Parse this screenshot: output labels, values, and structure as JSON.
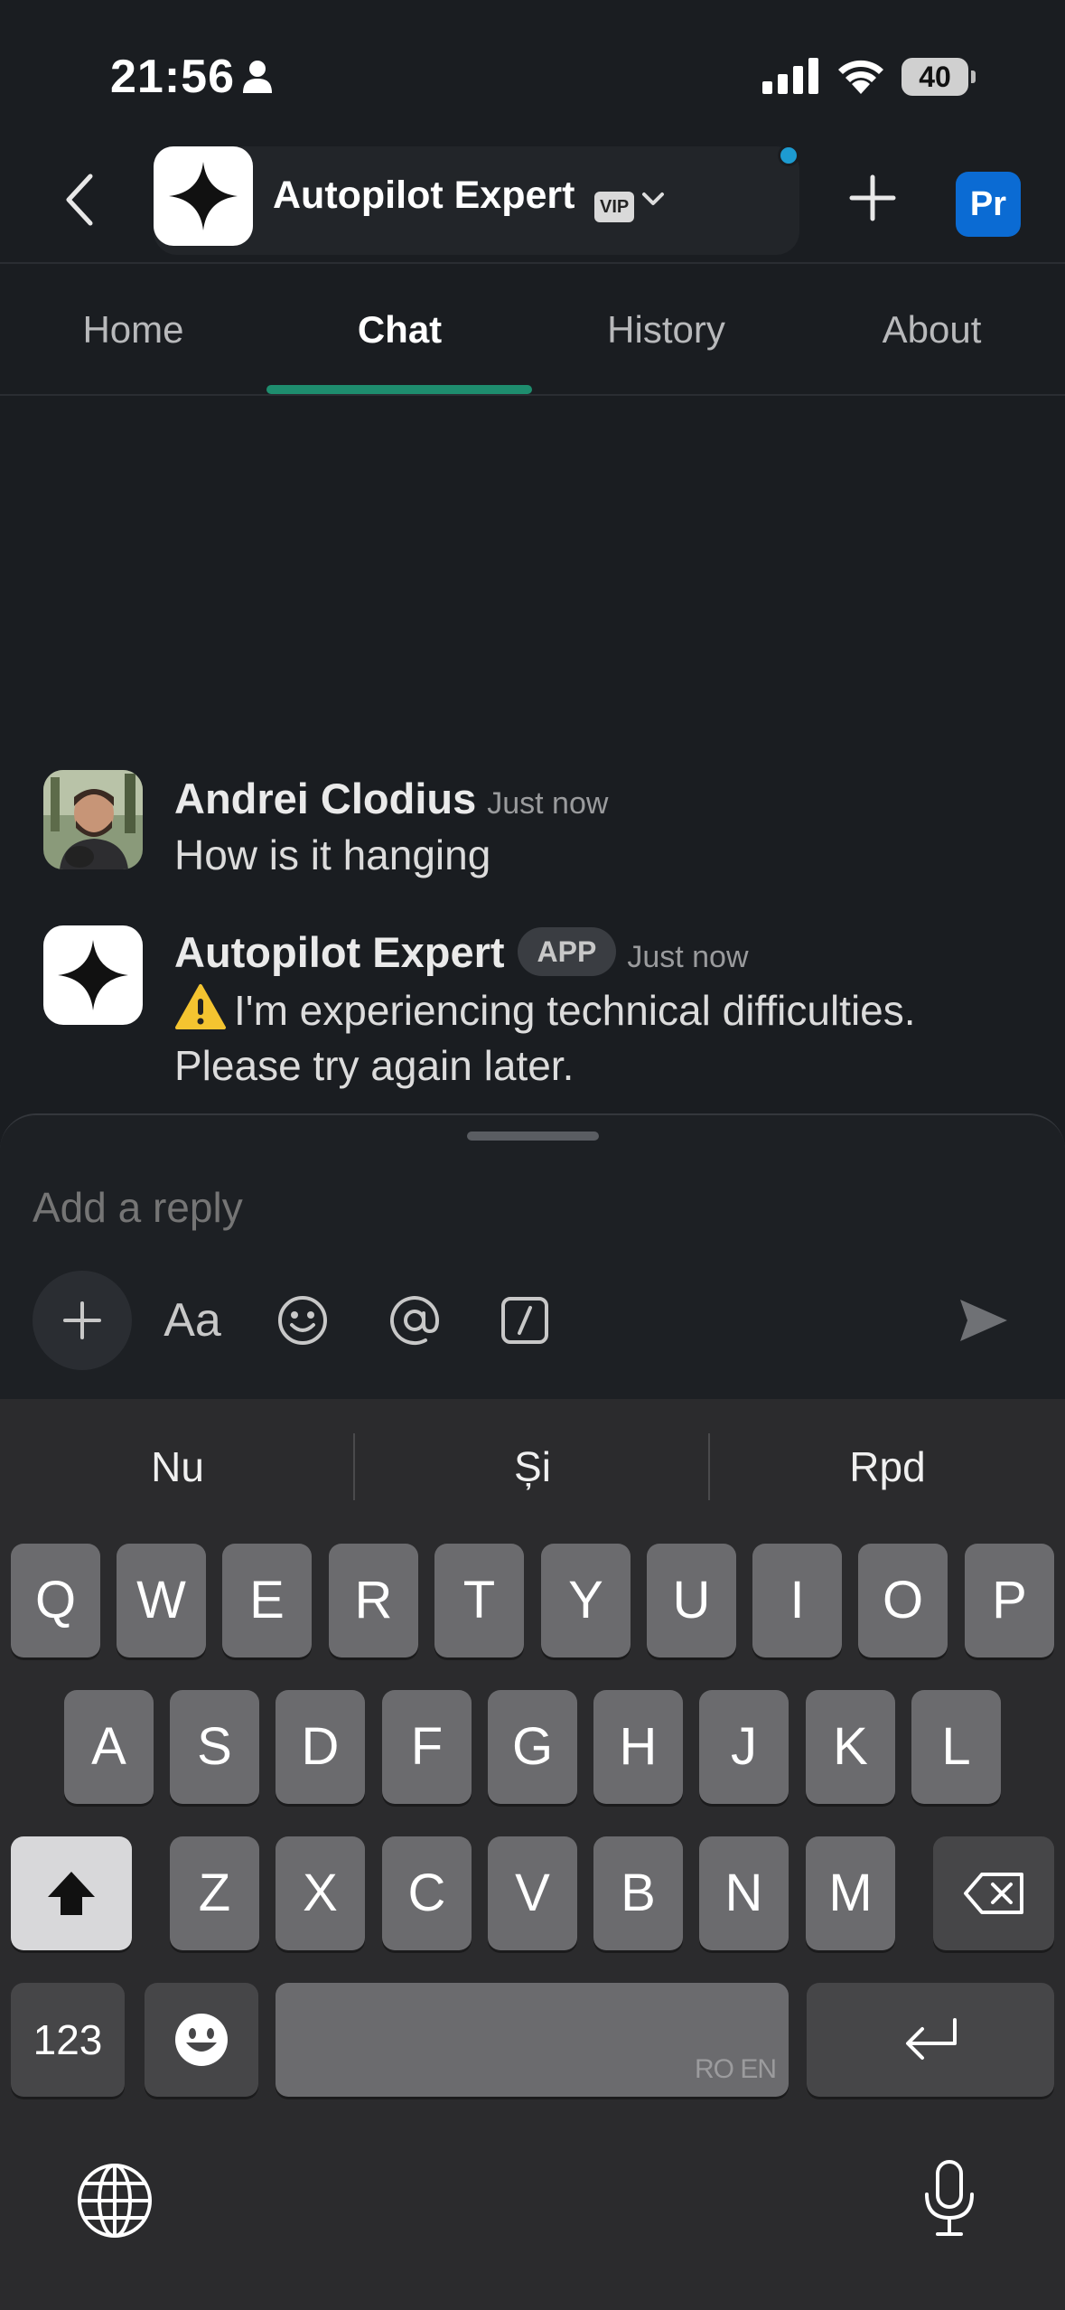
{
  "status_bar": {
    "time": "21:56",
    "battery": "40"
  },
  "header": {
    "channel_name": "Autopilot Expert",
    "vip_badge": "VIP",
    "workspace_initials": "Pr"
  },
  "tabs": [
    {
      "label": "Home",
      "active": false
    },
    {
      "label": "Chat",
      "active": true
    },
    {
      "label": "History",
      "active": false
    },
    {
      "label": "About",
      "active": false
    }
  ],
  "messages": [
    {
      "author": "Andrei Clodius",
      "time": "Just now",
      "text": "How is it hanging"
    },
    {
      "author": "Autopilot Expert",
      "app_tag": "APP",
      "time": "Just now",
      "icon": "warning-icon",
      "text": "I'm experiencing technical difficulties. Please try again later."
    }
  ],
  "composer": {
    "placeholder": "Add a reply",
    "format_label": "Aa"
  },
  "keyboard": {
    "suggestions": [
      "Nu",
      "Și",
      "Rpd"
    ],
    "row1": [
      "Q",
      "W",
      "E",
      "R",
      "T",
      "Y",
      "U",
      "I",
      "O",
      "P"
    ],
    "row2": [
      "A",
      "S",
      "D",
      "F",
      "G",
      "H",
      "J",
      "K",
      "L"
    ],
    "row3": [
      "Z",
      "X",
      "C",
      "V",
      "B",
      "N",
      "M"
    ],
    "numbers_label": "123",
    "space_label": "RO EN"
  },
  "colors": {
    "accent_tab": "#1e8d6e",
    "workspace": "#0b6bd3",
    "unread": "#1d9bd1"
  }
}
